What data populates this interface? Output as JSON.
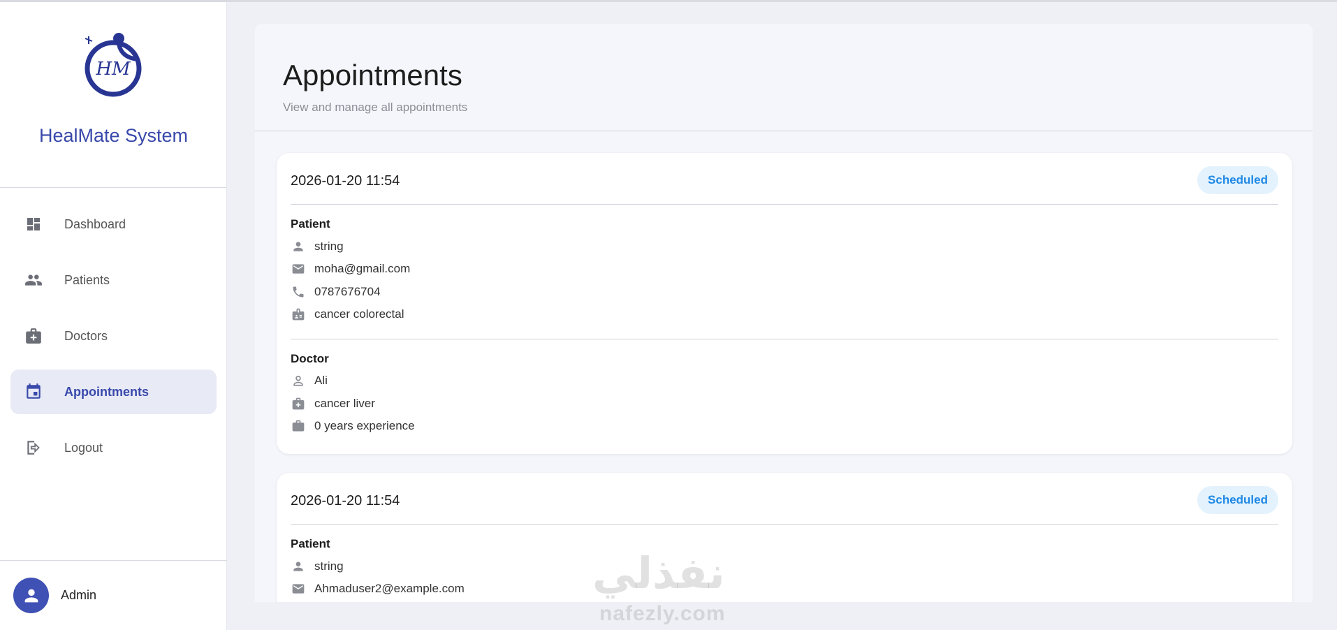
{
  "app": {
    "brand_name": "HealMate System",
    "logo_monogram": "HM",
    "accent_color": "#3949ab"
  },
  "sidebar": {
    "items": [
      {
        "label": "Dashboard",
        "icon": "dashboard-icon",
        "active": false
      },
      {
        "label": "Patients",
        "icon": "people-icon",
        "active": false
      },
      {
        "label": "Doctors",
        "icon": "medical-bag-icon",
        "active": false
      },
      {
        "label": "Appointments",
        "icon": "calendar-icon",
        "active": true
      },
      {
        "label": "Logout",
        "icon": "logout-icon",
        "active": false
      }
    ],
    "user": {
      "name": "Admin",
      "icon": "person-icon"
    }
  },
  "page": {
    "title": "Appointments",
    "subtitle": "View and manage all appointments"
  },
  "appointments": [
    {
      "datetime": "2026-01-20 11:54",
      "status": "Scheduled",
      "patient_heading": "Patient",
      "patient": {
        "name": "string",
        "email": "moha@gmail.com",
        "phone": "0787676704",
        "condition": "cancer colorectal"
      },
      "doctor_heading": "Doctor",
      "doctor": {
        "name": "Ali",
        "specialty": "cancer liver",
        "experience": "0 years experience"
      }
    },
    {
      "datetime": "2026-01-20 11:54",
      "status": "Scheduled",
      "patient_heading": "Patient",
      "patient": {
        "name": "string",
        "email": "Ahmaduser2@example.com"
      }
    }
  ],
  "watermark": {
    "arabic": "نفذلي",
    "latin": "nafezly.com"
  },
  "colors": {
    "status_bg": "#e3f2fd",
    "status_text": "#1e88e5",
    "active_nav_bg": "#e8eaf6"
  }
}
